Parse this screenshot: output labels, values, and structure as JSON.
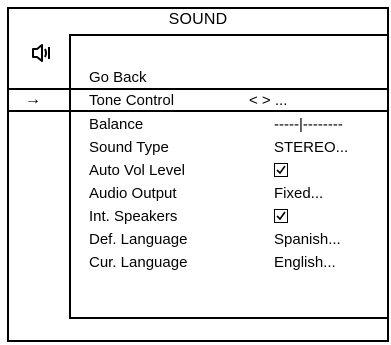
{
  "menu": {
    "title": "SOUND",
    "items": [
      {
        "label": "Go Back",
        "value": ""
      },
      {
        "label": "Tone Control",
        "value": "< > ...",
        "selected": true,
        "indicator": "→"
      },
      {
        "label": "Balance",
        "value": "-----|--------"
      },
      {
        "label": "Sound Type",
        "value": "STEREO..."
      },
      {
        "label": "Auto Vol Level",
        "value": "",
        "checked": true
      },
      {
        "label": "Audio Output",
        "value": "Fixed..."
      },
      {
        "label": "Int. Speakers",
        "value": "",
        "checked": true
      },
      {
        "label": "Def. Language",
        "value": "Spanish..."
      },
      {
        "label": "Cur. Language",
        "value": "English..."
      }
    ]
  },
  "icons": {
    "section_icon": "speaker-icon",
    "selection_indicator": "right-arrow-icon",
    "checkbox_icon": "checkbox-checked-icon"
  }
}
